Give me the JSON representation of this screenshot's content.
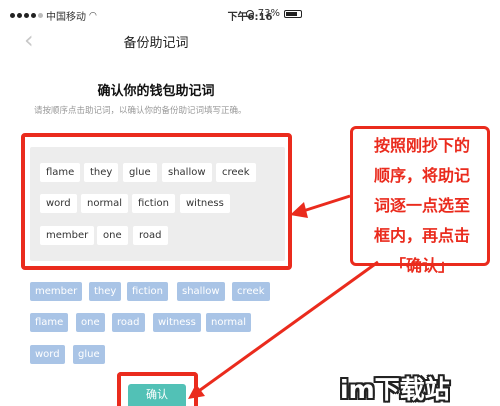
{
  "status_bar": {
    "carrier": "中国移动",
    "time": "下午6:16",
    "battery": "73%"
  },
  "nav": {
    "title": "备份助记词"
  },
  "main": {
    "heading": "确认你的钱包助记词",
    "instruction": "请按顺序点击助记词，以确认你的备份助记词填写正确。",
    "selected_words": [
      "flame",
      "they",
      "glue",
      "shallow",
      "creek",
      "word",
      "normal",
      "fiction",
      "witness",
      "member",
      "one",
      "road"
    ],
    "available_words": [
      "member",
      "they",
      "fiction",
      "shallow",
      "creek",
      "flame",
      "one",
      "road",
      "witness",
      "normal",
      "word",
      "glue"
    ],
    "confirm_label": "确认"
  },
  "annotation": {
    "lines": [
      "按照刚抄下的",
      "顺序，将助记",
      "词逐一点选至",
      "框内，再点击",
      "「确认」"
    ]
  },
  "watermark": {
    "text": "im下载站"
  },
  "colors": {
    "highlight_red": "#ea2b1d",
    "chip_blue": "#a9c4e6",
    "confirm_teal": "#52c1b6"
  }
}
